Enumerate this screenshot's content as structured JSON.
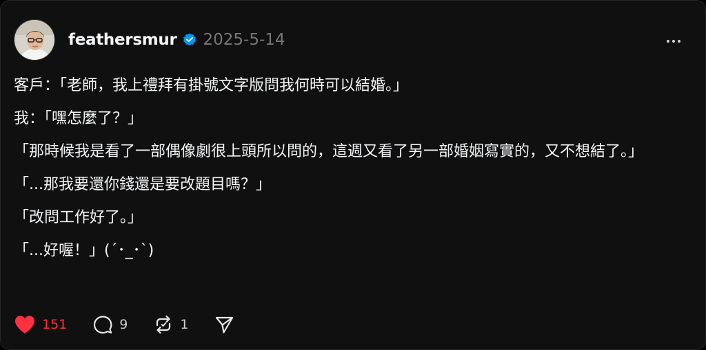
{
  "post": {
    "author": {
      "username": "feathersmur",
      "verified": true,
      "avatar_icon": "avatar-photo"
    },
    "date": "2025-5-14",
    "paragraphs": [
      "客戶：「老師，我上禮拜有掛號文字版問我何時可以結婚。」",
      "我：「嘿怎麼了？」",
      "「那時候我是看了一部偶像劇很上頭所以問的，這週又看了另一部婚姻寫實的，又不想結了。」",
      "「...那我要還你錢還是要改題目嗎？」",
      "「改問工作好了。」",
      "「...好喔！」(´･_･`)"
    ],
    "actions": {
      "likes": "151",
      "comments": "9",
      "reposts": "1",
      "liked": true
    }
  },
  "colors": {
    "background": "#101010",
    "text": "#f3f5f7",
    "muted": "#777777",
    "like": "#ff3040",
    "verified": "#0095f6"
  }
}
